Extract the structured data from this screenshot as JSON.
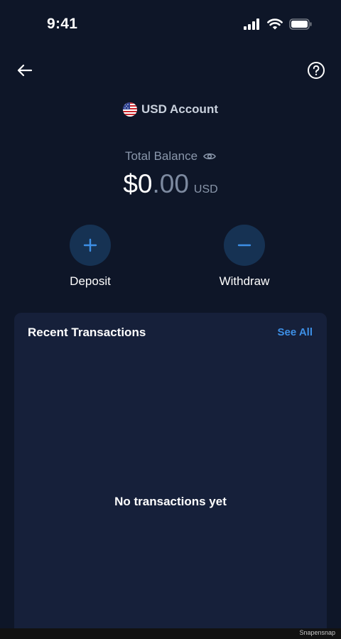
{
  "status_bar": {
    "time": "9:41",
    "icons": [
      "cellular-signal-icon",
      "wifi-icon",
      "battery-icon"
    ]
  },
  "nav": {
    "back_icon": "arrow-left-icon",
    "help_icon": "question-circle-icon"
  },
  "account": {
    "flag_icon": "us-flag-icon",
    "title": "USD Account"
  },
  "balance": {
    "label": "Total Balance",
    "visibility_icon": "eye-icon",
    "whole": "$0",
    "fraction": ".00",
    "currency": "USD"
  },
  "actions": [
    {
      "label": "Deposit",
      "icon": "plus-icon"
    },
    {
      "label": "Withdraw",
      "icon": "minus-icon"
    }
  ],
  "transactions": {
    "title": "Recent Transactions",
    "see_all": "See All",
    "empty_message": "No transactions yet"
  },
  "footer": {
    "text": "Snapensnap"
  },
  "colors": {
    "background": "#0e1628",
    "card": "#16203a",
    "accent": "#3d8fe6",
    "action_circle": "#163253"
  }
}
